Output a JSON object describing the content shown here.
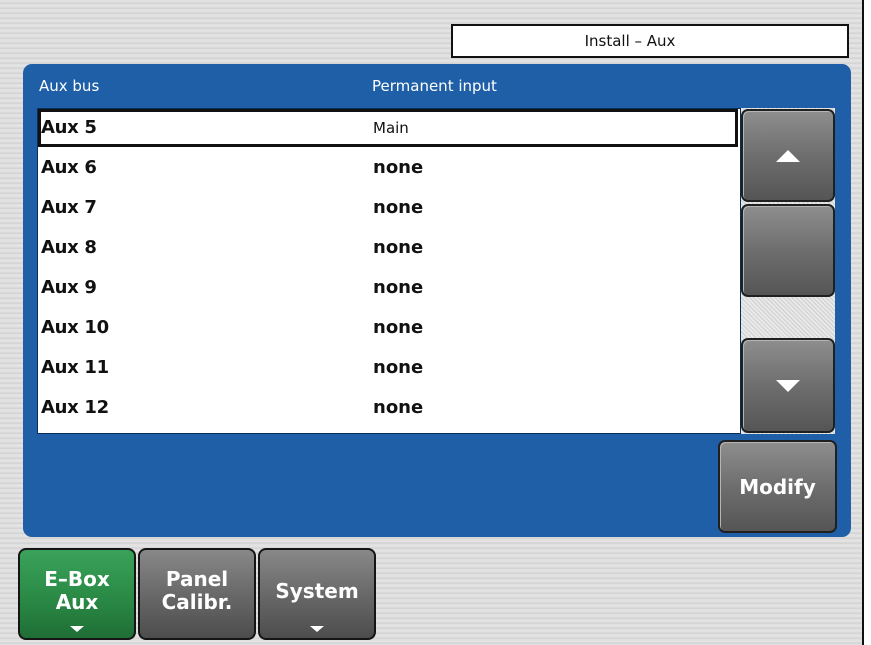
{
  "header": {
    "title": "Install – Aux"
  },
  "table": {
    "columns": [
      "Aux bus",
      "Permanent input"
    ],
    "rows": [
      {
        "bus": "Aux 5",
        "input": "Main",
        "selected": true
      },
      {
        "bus": "Aux 6",
        "input": "none"
      },
      {
        "bus": "Aux 7",
        "input": "none"
      },
      {
        "bus": "Aux 8",
        "input": "none"
      },
      {
        "bus": "Aux 9",
        "input": "none"
      },
      {
        "bus": "Aux 10",
        "input": "none"
      },
      {
        "bus": "Aux 11",
        "input": "none"
      },
      {
        "bus": "Aux 12",
        "input": "none"
      }
    ]
  },
  "buttons": {
    "scroll_up_icon": "triangle-up",
    "scroll_down_icon": "triangle-down",
    "modify_label": "Modify"
  },
  "tabs": [
    {
      "line1": "E–Box",
      "line2": "Aux",
      "active": true,
      "has_menu": true
    },
    {
      "line1": "Panel",
      "line2": "Calibr.",
      "active": false,
      "has_menu": false
    },
    {
      "line1": "System",
      "line2": "",
      "active": false,
      "has_menu": true
    }
  ],
  "colors": {
    "panel": "#1f5fa7",
    "active_tab": "#2a8a45",
    "button_gray": "#6e6e6e"
  }
}
